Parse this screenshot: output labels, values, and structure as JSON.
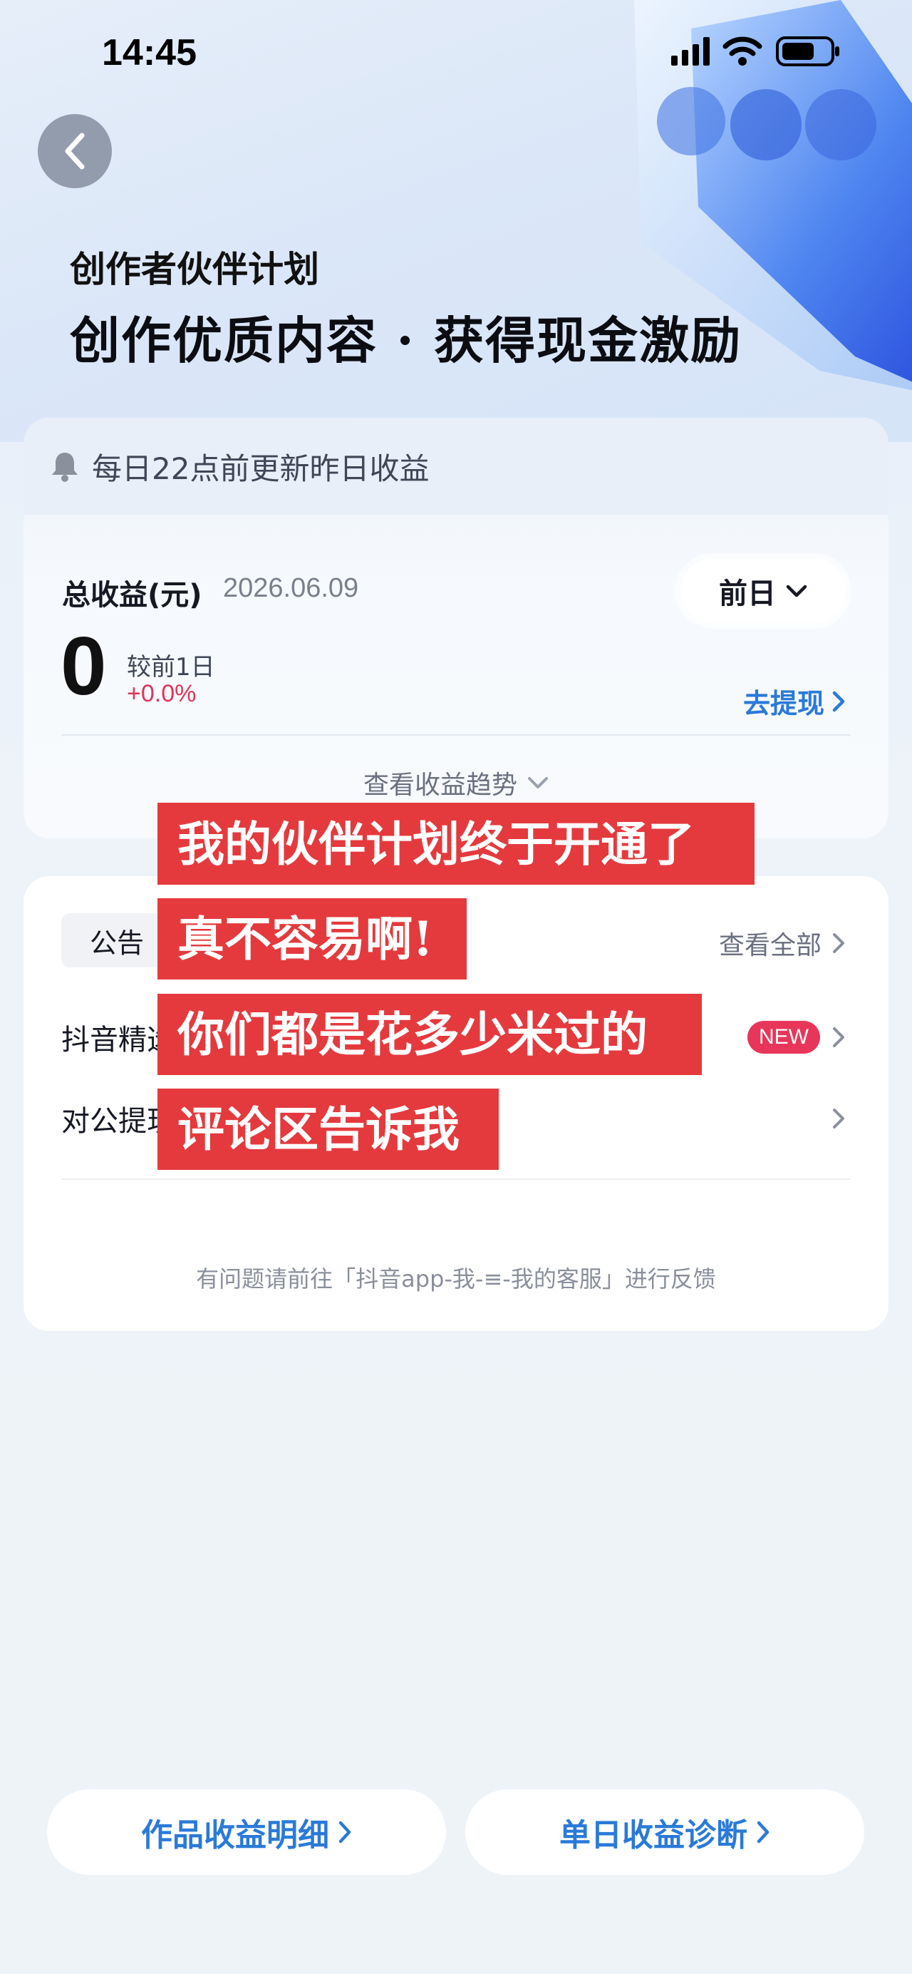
{
  "status_bar": {
    "time": "14:45"
  },
  "hero": {
    "subtitle": "创作者伙伴计划",
    "title": "创作优质内容 · 获得现金激励"
  },
  "earnings_card": {
    "notice": "每日22点前更新昨日收益",
    "total_label": "总收益(元)",
    "date": "2026.06.09",
    "period_selected": "前日",
    "total_value": "0",
    "compare_label": "较前1日",
    "compare_value": "+0.0%",
    "withdraw_label": "去提现",
    "trend_label": "查看收益趋势"
  },
  "announcements": {
    "tag": "公告",
    "see_all": "查看全部",
    "row1_text": "抖音精选",
    "row1_badge": "NEW",
    "row2_text": "对公提现",
    "footer": "有问题请前往「抖音app-我-≡-我的客服」进行反馈"
  },
  "captions": [
    "我的伙伴计划终于开通了",
    "真不容易啊!",
    "你们都是花多少米过的",
    "评论区告诉我"
  ],
  "bottom_buttons": {
    "works_detail": "作品收益明细",
    "daily_diagnosis": "单日收益诊断"
  },
  "colors": {
    "accent_blue": "#2a7ad8",
    "caption_red": "#e43a3e",
    "badge_red": "#e8365b"
  }
}
